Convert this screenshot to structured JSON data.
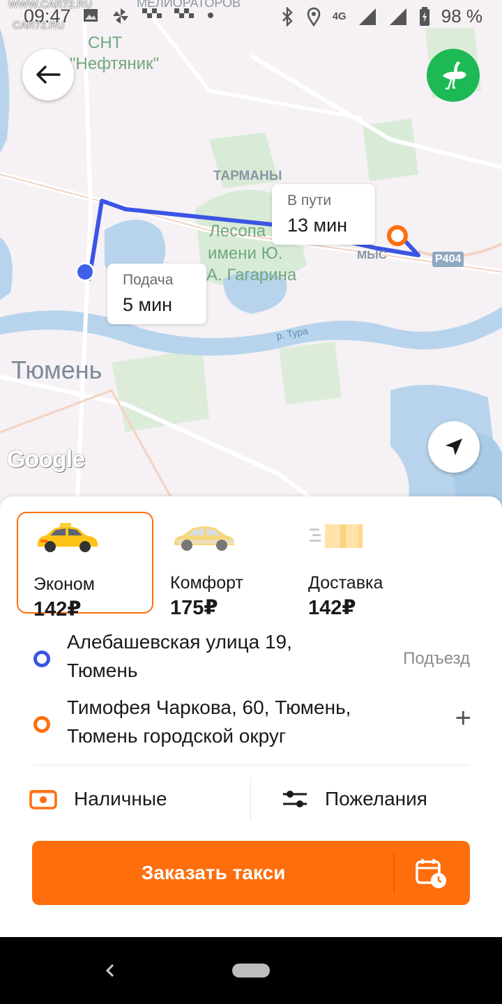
{
  "status_bar": {
    "time": "09:47",
    "battery": "98 %",
    "network": "4G",
    "watermark_top": "WWW.CAR72.RU",
    "watermark_bottom": "CAR72.RU"
  },
  "map": {
    "labels": {
      "district_top": "МЕЛИОРАТОРОВ",
      "snt_line1": "СНТ",
      "snt_line2": "\"Нефтяник\"",
      "tarmany": "ТАРМАНЫ",
      "park_line1": "Лесопа",
      "park_line2": "имени Ю.",
      "park_line3": "А. Гагарина",
      "mys": "МЫС",
      "road": "Р404",
      "river": "р. Тура",
      "city": "Тюмень"
    },
    "pickup_bubble": {
      "label": "Подача",
      "value": "5 мин"
    },
    "trip_bubble": {
      "label": "В пути",
      "value": "13 мин"
    },
    "attribution": "Google"
  },
  "tariffs": [
    {
      "name": "Эконом",
      "price": "142₽",
      "selected": true
    },
    {
      "name": "Комфорт",
      "price": "175₽",
      "selected": false
    },
    {
      "name": "Доставка",
      "price": "142₽",
      "selected": false
    }
  ],
  "route": {
    "from": {
      "line1": "Алебашевская улица 19,",
      "line2": "Тюмень",
      "action": "Подъезд"
    },
    "to": {
      "line1": "Тимофея Чаркова, 60, Тюмень,",
      "line2": "Тюмень городской округ",
      "action": "+"
    }
  },
  "options": {
    "payment": "Наличные",
    "preferences": "Пожелания"
  },
  "order_button": {
    "label": "Заказать такси"
  },
  "colors": {
    "accent": "#ff6e0d",
    "route": "#3a55e4",
    "green_button": "#1db954"
  }
}
